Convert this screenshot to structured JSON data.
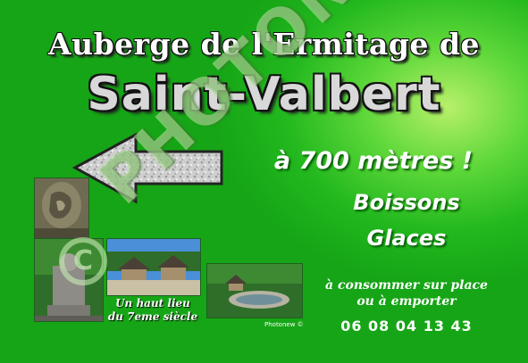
{
  "poster": {
    "title_line1": "Auberge de l'Ermitage de",
    "title_line2": "Saint-Valbert",
    "distance": "à 700 mètres !",
    "drink": "Boissons",
    "icecream": "Glaces",
    "serve_line1": "à consommer sur place",
    "serve_line2": "ou à emporter",
    "phone": "06 08 04 13 43",
    "caption_line1": "Un haut lieu",
    "caption_line2": "du 7eme siècle",
    "photo_credit": "Photonew ©",
    "watermark": "PHOTONEW",
    "copyright_symbol": "C"
  },
  "colors": {
    "background": "#22b81e",
    "highlight": "#b8f06a",
    "text": "#ffffff",
    "arrow": "#d8d8d8"
  },
  "icons": [
    "left-arrow",
    "photo-rock-carving",
    "photo-stone-statue",
    "photo-chapel-huts",
    "photo-garden-pool"
  ]
}
